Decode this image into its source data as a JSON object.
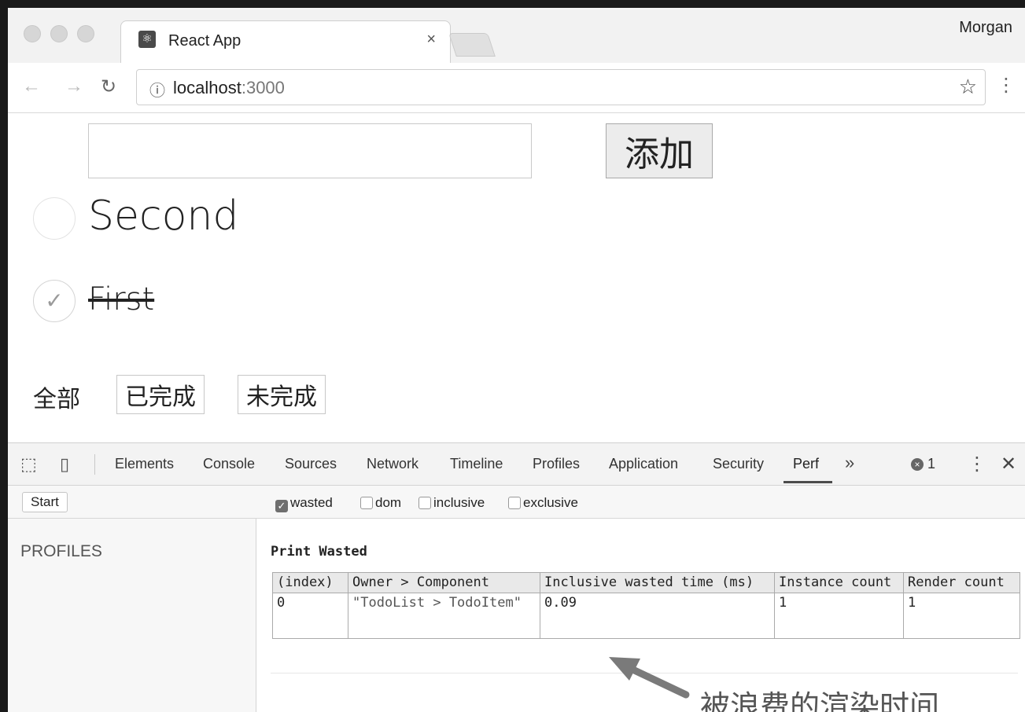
{
  "browser": {
    "tab_title": "React App",
    "tab_close": "×",
    "profile": "Morgan",
    "url_host": "localhost",
    "url_port": ":3000",
    "icons": [
      "back-arrow-icon",
      "forward-arrow-icon",
      "reload-icon",
      "info-icon",
      "star-icon",
      "menu-icon"
    ]
  },
  "app": {
    "input_value": "",
    "add_button": "添加",
    "todos": [
      {
        "text": "Second",
        "completed": false
      },
      {
        "text": "First",
        "completed": true
      }
    ],
    "filters": {
      "all": "全部",
      "completed": "已完成",
      "active": "未完成"
    }
  },
  "devtools": {
    "tabs": [
      "Elements",
      "Console",
      "Sources",
      "Network",
      "Timeline",
      "Profiles",
      "Application",
      "Security",
      "Perf"
    ],
    "active_tab": "Perf",
    "more": "»",
    "error_count": "1",
    "start_button": "Start",
    "checkboxes": [
      {
        "label": "wasted",
        "checked": true
      },
      {
        "label": "dom",
        "checked": false
      },
      {
        "label": "inclusive",
        "checked": false
      },
      {
        "label": "exclusive",
        "checked": false
      }
    ],
    "profiles_label": "PROFILES",
    "print_title": "Print Wasted",
    "table": {
      "headers": [
        "(index)",
        "Owner > Component",
        "Inclusive wasted time (ms)",
        "Instance count",
        "Render count"
      ],
      "rows": [
        [
          "0",
          "\"TodoList > TodoItem\"",
          "0.09",
          "1",
          "1"
        ]
      ]
    }
  },
  "annotation": "被浪费的渲染时间",
  "colors": {
    "chrome_bg": "#f2f2f2",
    "devtools_bg": "#f3f3f3",
    "border": "#cfcfcf",
    "arrow": "#7a7a7a"
  }
}
